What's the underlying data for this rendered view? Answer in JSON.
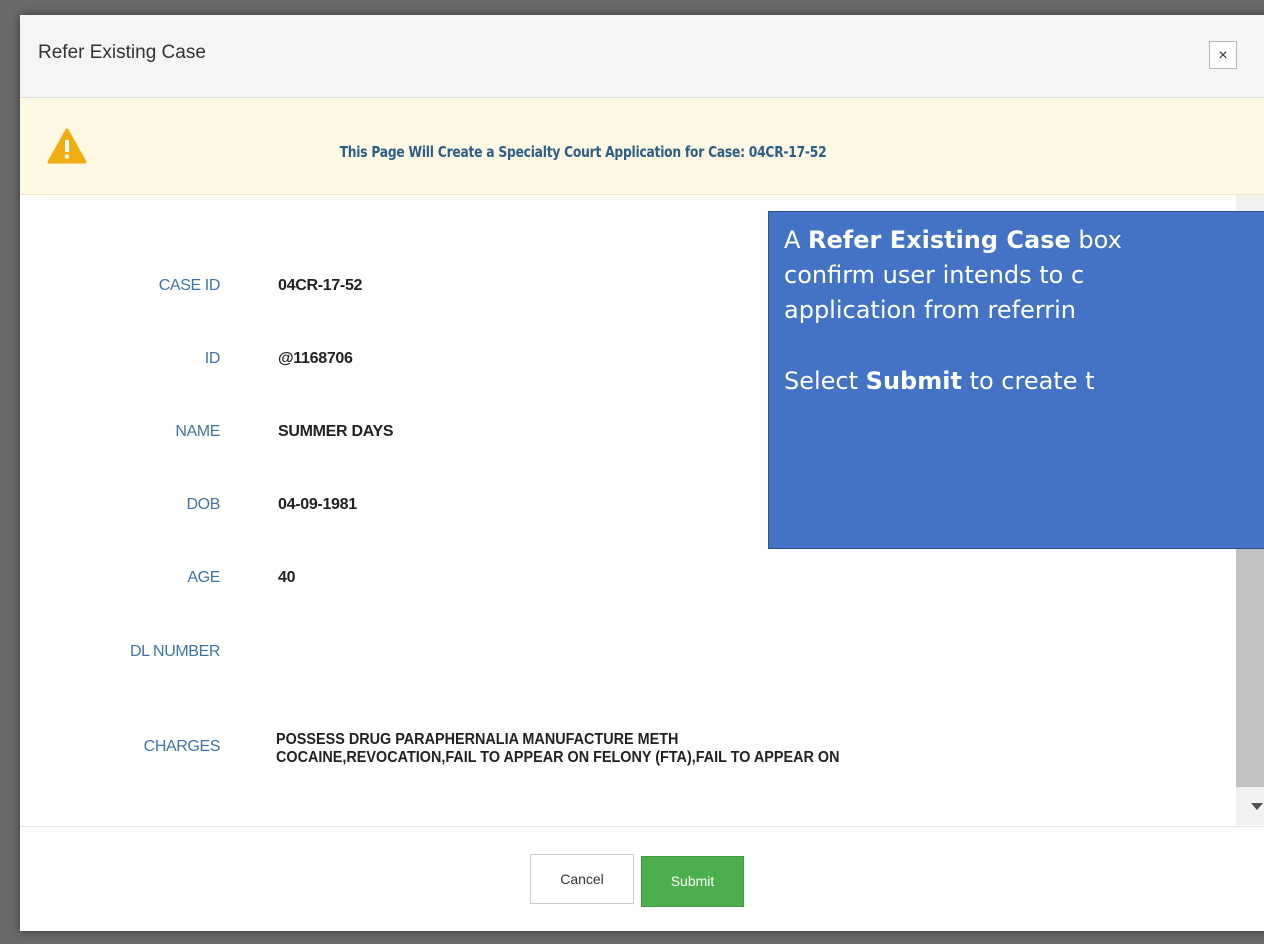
{
  "dialog": {
    "title": "Refer Existing Case",
    "close_label": "×"
  },
  "alert": {
    "message": "This Page Will Create a Specialty Court Application for Case: 04CR-17-52"
  },
  "fields": [
    {
      "label": "CASE ID",
      "value": "04CR-17-52"
    },
    {
      "label": "ID",
      "value": "@1168706"
    },
    {
      "label": "NAME",
      "value": "SUMMER DAYS"
    },
    {
      "label": "DOB",
      "value": "04-09-1981"
    },
    {
      "label": "AGE",
      "value": "40"
    },
    {
      "label": "DL NUMBER",
      "value": ""
    },
    {
      "label": "CHARGES",
      "line1": "POSSESS DRUG PARAPHERNALIA MANUFACTURE METH",
      "line2": "COCAINE,REVOCATION,FAIL TO APPEAR ON FELONY (FTA),FAIL TO APPEAR ON"
    }
  ],
  "footer": {
    "cancel_label": "Cancel",
    "submit_label": "Submit"
  },
  "callout": {
    "line1_pre": "A ",
    "line1_bold": "Refer Existing Case",
    "line1_post": " box",
    "line2": "confirm user intends to c",
    "line3": "application from referrin",
    "line4_pre": "Select ",
    "line4_bold": "Submit",
    "line4_post": " to create t"
  },
  "colors": {
    "label": "#3f74a8",
    "alert_text": "#2e5e88",
    "submit": "#4cae4c",
    "callout": "#4472c4",
    "warning_icon": "#f0ad12"
  }
}
